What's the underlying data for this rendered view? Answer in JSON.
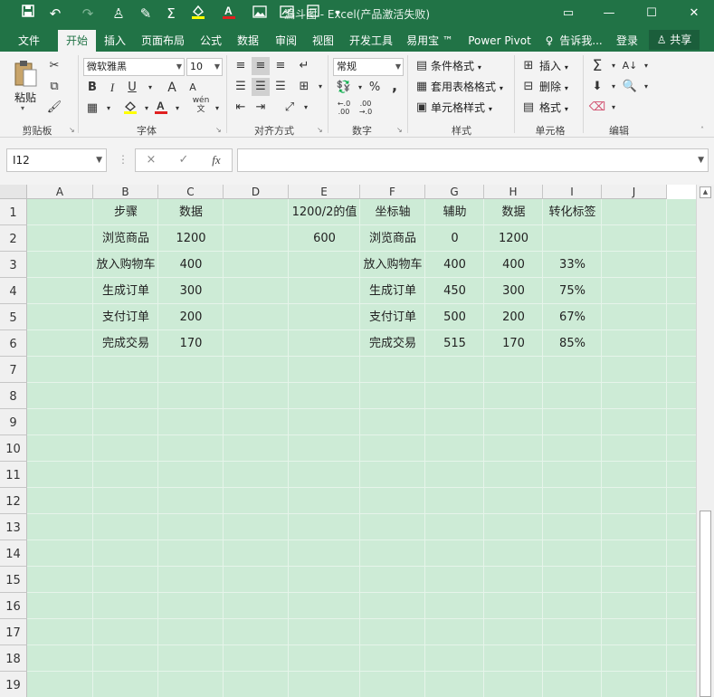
{
  "window": {
    "title": "漏斗图 - Excel(产品激活失败)",
    "colors": {
      "accent": "#217346",
      "sheet_fill": "#cdebd6"
    },
    "quick_access_icons": [
      "save-icon",
      "undo-icon",
      "redo-icon",
      "person-icon",
      "brush-icon",
      "sigma-icon",
      "fill-color-icon",
      "font-color-icon",
      "picture-icon",
      "chart-icon",
      "form-icon"
    ],
    "window_icons": [
      "ribbon-display-icon",
      "minimize-icon",
      "restore-icon",
      "close-icon"
    ]
  },
  "tabs": [
    "文件",
    "开始",
    "插入",
    "页面布局",
    "公式",
    "数据",
    "审阅",
    "视图",
    "开发工具",
    "易用宝 ™",
    "Power Pivot",
    "告诉我...",
    "登录"
  ],
  "active_tab": "开始",
  "share_label": "共享",
  "ribbon": {
    "clipboard": {
      "paste": "粘贴",
      "label": "剪贴板"
    },
    "font": {
      "name": "微软雅黑",
      "size": "10",
      "bold": "B",
      "italic": "I",
      "underline": "U",
      "grow": "A",
      "shrink": "A",
      "wen": "wén\n文",
      "label": "字体"
    },
    "alignment": {
      "label": "对齐方式"
    },
    "number": {
      "format": "常规",
      "percent": "%",
      "comma": ",",
      "label": "数字"
    },
    "styles": {
      "conditional": "条件格式",
      "table": "套用表格格式",
      "cell_styles": "单元格样式",
      "label": "样式"
    },
    "cells": {
      "insert": "插入",
      "delete": "删除",
      "format": "格式",
      "label": "单元格"
    },
    "editing": {
      "label": "编辑"
    }
  },
  "formula_bar": {
    "name_box": "I12",
    "cancel": "×",
    "enter": "✓",
    "fx": "fx",
    "value": ""
  },
  "columns": [
    "A",
    "B",
    "C",
    "D",
    "E",
    "F",
    "G",
    "H",
    "I",
    "J"
  ],
  "rows": [
    "1",
    "2",
    "3",
    "4",
    "5",
    "6",
    "7",
    "8",
    "9",
    "10",
    "11",
    "12",
    "13",
    "14",
    "15",
    "16",
    "17",
    "18",
    "19"
  ],
  "cells": {
    "B1": "步骤",
    "C1": "数据",
    "E1": "1200/2的值",
    "F1": "坐标轴",
    "G1": "辅助",
    "H1": "数据",
    "I1": "转化标签",
    "B2": "浏览商品",
    "C2": "1200",
    "E2": "600",
    "F2": "浏览商品",
    "G2": "0",
    "H2": "1200",
    "B3": "放入购物车",
    "C3": "400",
    "F3": "放入购物车",
    "G3": "400",
    "H3": "400",
    "I3": "33%",
    "B4": "生成订单",
    "C4": "300",
    "F4": "生成订单",
    "G4": "450",
    "H4": "300",
    "I4": "75%",
    "B5": "支付订单",
    "C5": "200",
    "F5": "支付订单",
    "G5": "500",
    "H5": "200",
    "I5": "67%",
    "B6": "完成交易",
    "C6": "170",
    "F6": "完成交易",
    "G6": "515",
    "H6": "170",
    "I6": "85%"
  }
}
